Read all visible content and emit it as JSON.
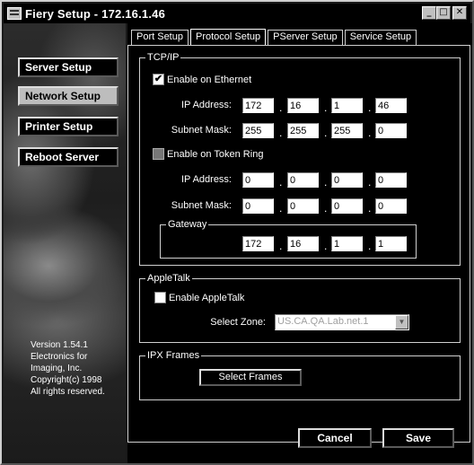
{
  "window": {
    "title": "Fiery Setup - 172.16.1.46"
  },
  "titlebar_buttons": {
    "minimize": "_",
    "maximize": "□",
    "close": "✕"
  },
  "sidebar": {
    "items": [
      {
        "label": "Server Setup",
        "active": false
      },
      {
        "label": "Network Setup",
        "active": true
      },
      {
        "label": "Printer Setup",
        "active": false
      },
      {
        "label": "Reboot Server",
        "active": false
      }
    ],
    "version_lines": [
      "Version 1.54.1",
      "Electronics for",
      "Imaging, Inc.",
      "Copyright(c) 1998",
      "All rights reserved."
    ]
  },
  "tabs": [
    {
      "label": "Port Setup",
      "active": false
    },
    {
      "label": "Protocol Setup",
      "active": true
    },
    {
      "label": "PServer Setup",
      "active": false
    },
    {
      "label": "Service Setup",
      "active": false
    }
  ],
  "tcpip": {
    "title": "TCP/IP",
    "ethernet": {
      "label": "Enable on Ethernet",
      "checked": "✔",
      "ip_label": "IP Address:",
      "ip": [
        "172",
        "16",
        "1",
        "46"
      ],
      "subnet_label": "Subnet Mask:",
      "subnet": [
        "255",
        "255",
        "255",
        "0"
      ]
    },
    "token_ring": {
      "label": "Enable on Token Ring",
      "ip_label": "IP Address:",
      "ip": [
        "0",
        "0",
        "0",
        "0"
      ],
      "subnet_label": "Subnet Mask:",
      "subnet": [
        "0",
        "0",
        "0",
        "0"
      ]
    },
    "gateway": {
      "title": "Gateway",
      "ip": [
        "172",
        "16",
        "1",
        "1"
      ]
    }
  },
  "appletalk": {
    "title": "AppleTalk",
    "enable_label": "Enable AppleTalk",
    "zone_label": "Select Zone:",
    "zone_value": "US.CA.QA.Lab.net.1"
  },
  "ipx": {
    "title": "IPX Frames",
    "button": "Select Frames"
  },
  "footer": {
    "cancel": "Cancel",
    "save": "Save"
  }
}
